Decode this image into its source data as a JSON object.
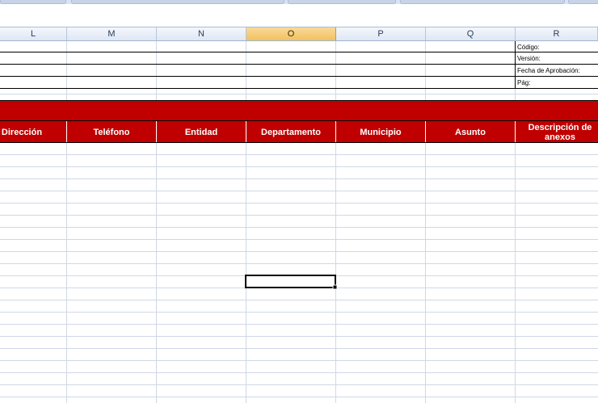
{
  "columns": [
    {
      "letter": "L",
      "selected": false
    },
    {
      "letter": "M",
      "selected": false
    },
    {
      "letter": "N",
      "selected": false
    },
    {
      "letter": "O",
      "selected": true
    },
    {
      "letter": "P",
      "selected": false
    },
    {
      "letter": "Q",
      "selected": false
    },
    {
      "letter": "R",
      "selected": false
    }
  ],
  "info_labels": [
    "Código:",
    "Versión:",
    "Fecha de Aprobación:",
    "Pág:"
  ],
  "table_headers": [
    "Dirección",
    "Teléfono",
    "Entidad",
    "Departamento",
    "Municipio",
    "Asunto",
    "Descripción de anexos"
  ],
  "colors": {
    "header_band": "#c00000",
    "gridline": "#d0d7e5",
    "column_header_selected": "#f1c15f"
  }
}
